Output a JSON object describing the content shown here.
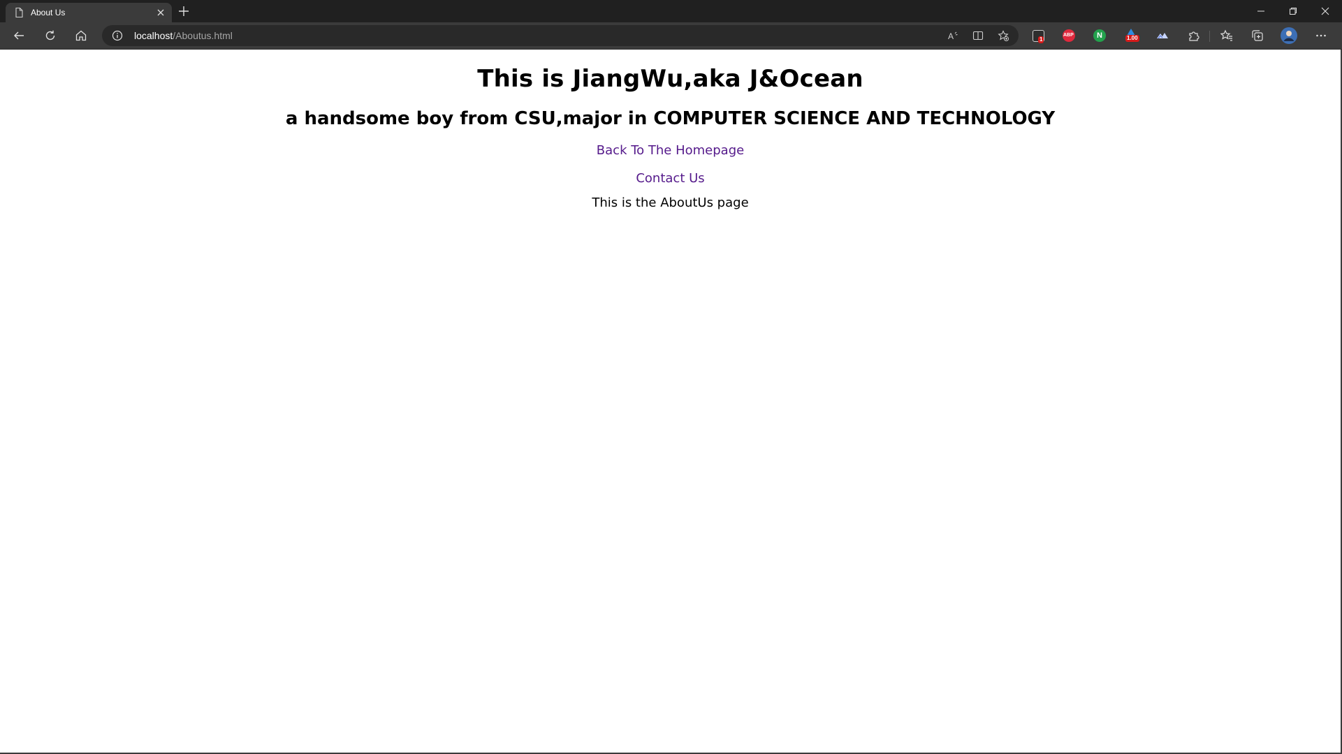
{
  "browser": {
    "tab": {
      "title": "About Us",
      "icon": "page-icon"
    },
    "window_controls": [
      "minimize",
      "restore",
      "close"
    ],
    "address": {
      "host": "localhost",
      "path": "/Aboutus.html"
    },
    "extensions": [
      {
        "name": "extension-screenshot-icon",
        "badge": "1"
      },
      {
        "name": "adblock-plus-icon",
        "label": "ABP"
      },
      {
        "name": "extension-n-icon",
        "label": "N"
      },
      {
        "name": "extension-speed-icon",
        "badge": "1.00"
      },
      {
        "name": "extension-mountain-icon"
      }
    ]
  },
  "page": {
    "heading": "This is JiangWu,aka J&Ocean",
    "subheading": "a handsome boy from CSU,major in COMPUTER SCIENCE AND TECHNOLOGY",
    "links": {
      "home": "Back To The Homepage",
      "contact": "Contact Us"
    },
    "body_text": "This is the AboutUs page"
  },
  "colors": {
    "chrome_dark": "#202020",
    "chrome_toolbar": "#3b3b3b",
    "link_visited": "#551a8b",
    "abp_red": "#e0293d",
    "n_green": "#23a24d"
  }
}
